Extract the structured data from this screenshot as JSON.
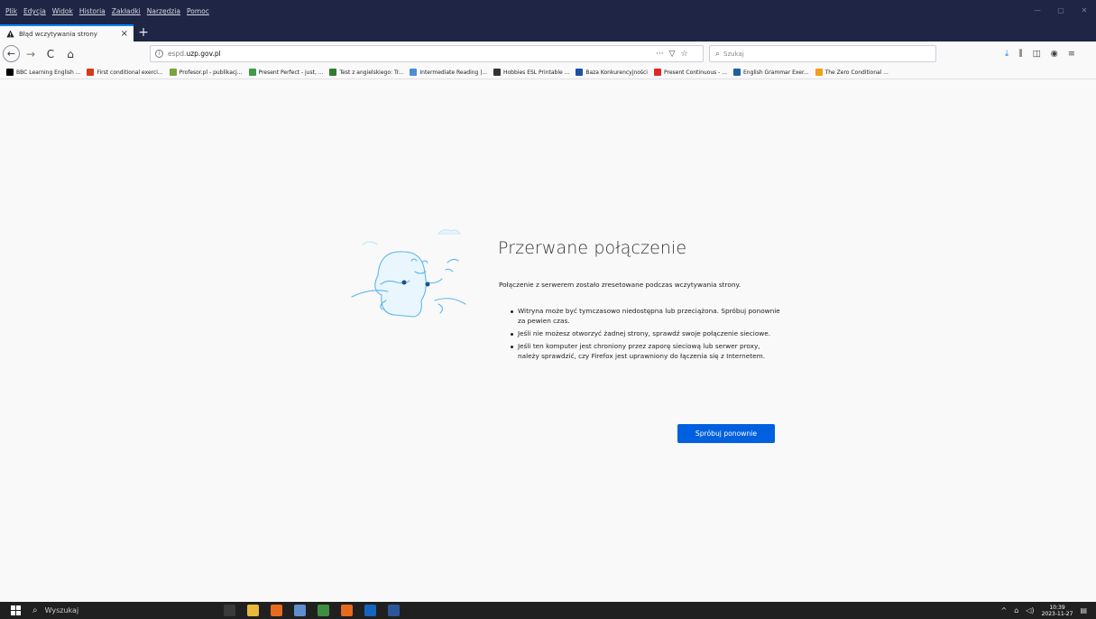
{
  "menu": [
    "Plik",
    "Edycja",
    "Widok",
    "Historia",
    "Zakładki",
    "Narzędzia",
    "Pomoc"
  ],
  "window_controls": [
    "—",
    "▢",
    "✕"
  ],
  "tab": {
    "title": "Błąd wczytywania strony",
    "close": "×",
    "new_tab": "+"
  },
  "nav": {
    "back": "←",
    "forward": "→",
    "reload": "C",
    "home": "⌂"
  },
  "url": {
    "host": "espd.",
    "domain": "uzp.gov.pl"
  },
  "url_actions": [
    "···",
    "▽",
    "☆"
  ],
  "search": {
    "placeholder": "Szukaj"
  },
  "toolbar_icons": [
    "download-icon",
    "library-icon",
    "sidebar-icon",
    "account-icon",
    "menu-icon"
  ],
  "bookmarks": [
    {
      "label": "BBC Learning English ...",
      "color": "#000000"
    },
    {
      "label": "First conditional exerci...",
      "color": "#d83a1a"
    },
    {
      "label": "Profesor.pl - publikacj...",
      "color": "#7aa43c"
    },
    {
      "label": "Present Perfect - just, ...",
      "color": "#3e9c4a"
    },
    {
      "label": "Test z angielskiego: Tr...",
      "color": "#2f7d31"
    },
    {
      "label": "Intermediate Reading |...",
      "color": "#4a8fd6"
    },
    {
      "label": "Hobbies ESL Printable ...",
      "color": "#333333"
    },
    {
      "label": "Baza Konkurencyjności",
      "color": "#1f4fa3"
    },
    {
      "label": "Present Continuous - ...",
      "color": "#e02727"
    },
    {
      "label": "English Grammar Exer...",
      "color": "#1f5f9e"
    },
    {
      "label": "The Zero Conditional ...",
      "color": "#f0a01a"
    }
  ],
  "error": {
    "title": "Przerwane połączenie",
    "description": "Połączenie z serwerem zostało zresetowane podczas wczytywania strony.",
    "items": [
      "Witryna może być tymczasowo niedostępna lub przeciążona. Spróbuj ponownie za pewien czas.",
      "Jeśli nie możesz otworzyć żadnej strony, sprawdź swoje połączenie sieciowe.",
      "Jeśli ten komputer jest chroniony przez zaporę sieciową lub serwer proxy, należy sprawdzić, czy Firefox jest uprawniony do łączenia się z Internetem."
    ],
    "retry_label": "Spróbuj ponownie"
  },
  "taskbar": {
    "search_placeholder": "Wyszukaj",
    "apps": [
      {
        "name": "task-view",
        "color": "#3a3a3a"
      },
      {
        "name": "file-explorer",
        "color": "#e9b93a"
      },
      {
        "name": "firefox",
        "color": "#e66b1f"
      },
      {
        "name": "paint",
        "color": "#5f8fd0"
      },
      {
        "name": "chrome",
        "color": "#3e8e41"
      },
      {
        "name": "firefox-2",
        "color": "#e66b1f"
      },
      {
        "name": "outlook",
        "color": "#1565c0"
      },
      {
        "name": "word",
        "color": "#2b579a"
      }
    ],
    "tray": {
      "time": "10:39",
      "date": "2023-11-27"
    }
  },
  "colors": {
    "accent": "#0060df",
    "titlebar": "#1f2544",
    "tab_accent": "#0a84ff"
  }
}
